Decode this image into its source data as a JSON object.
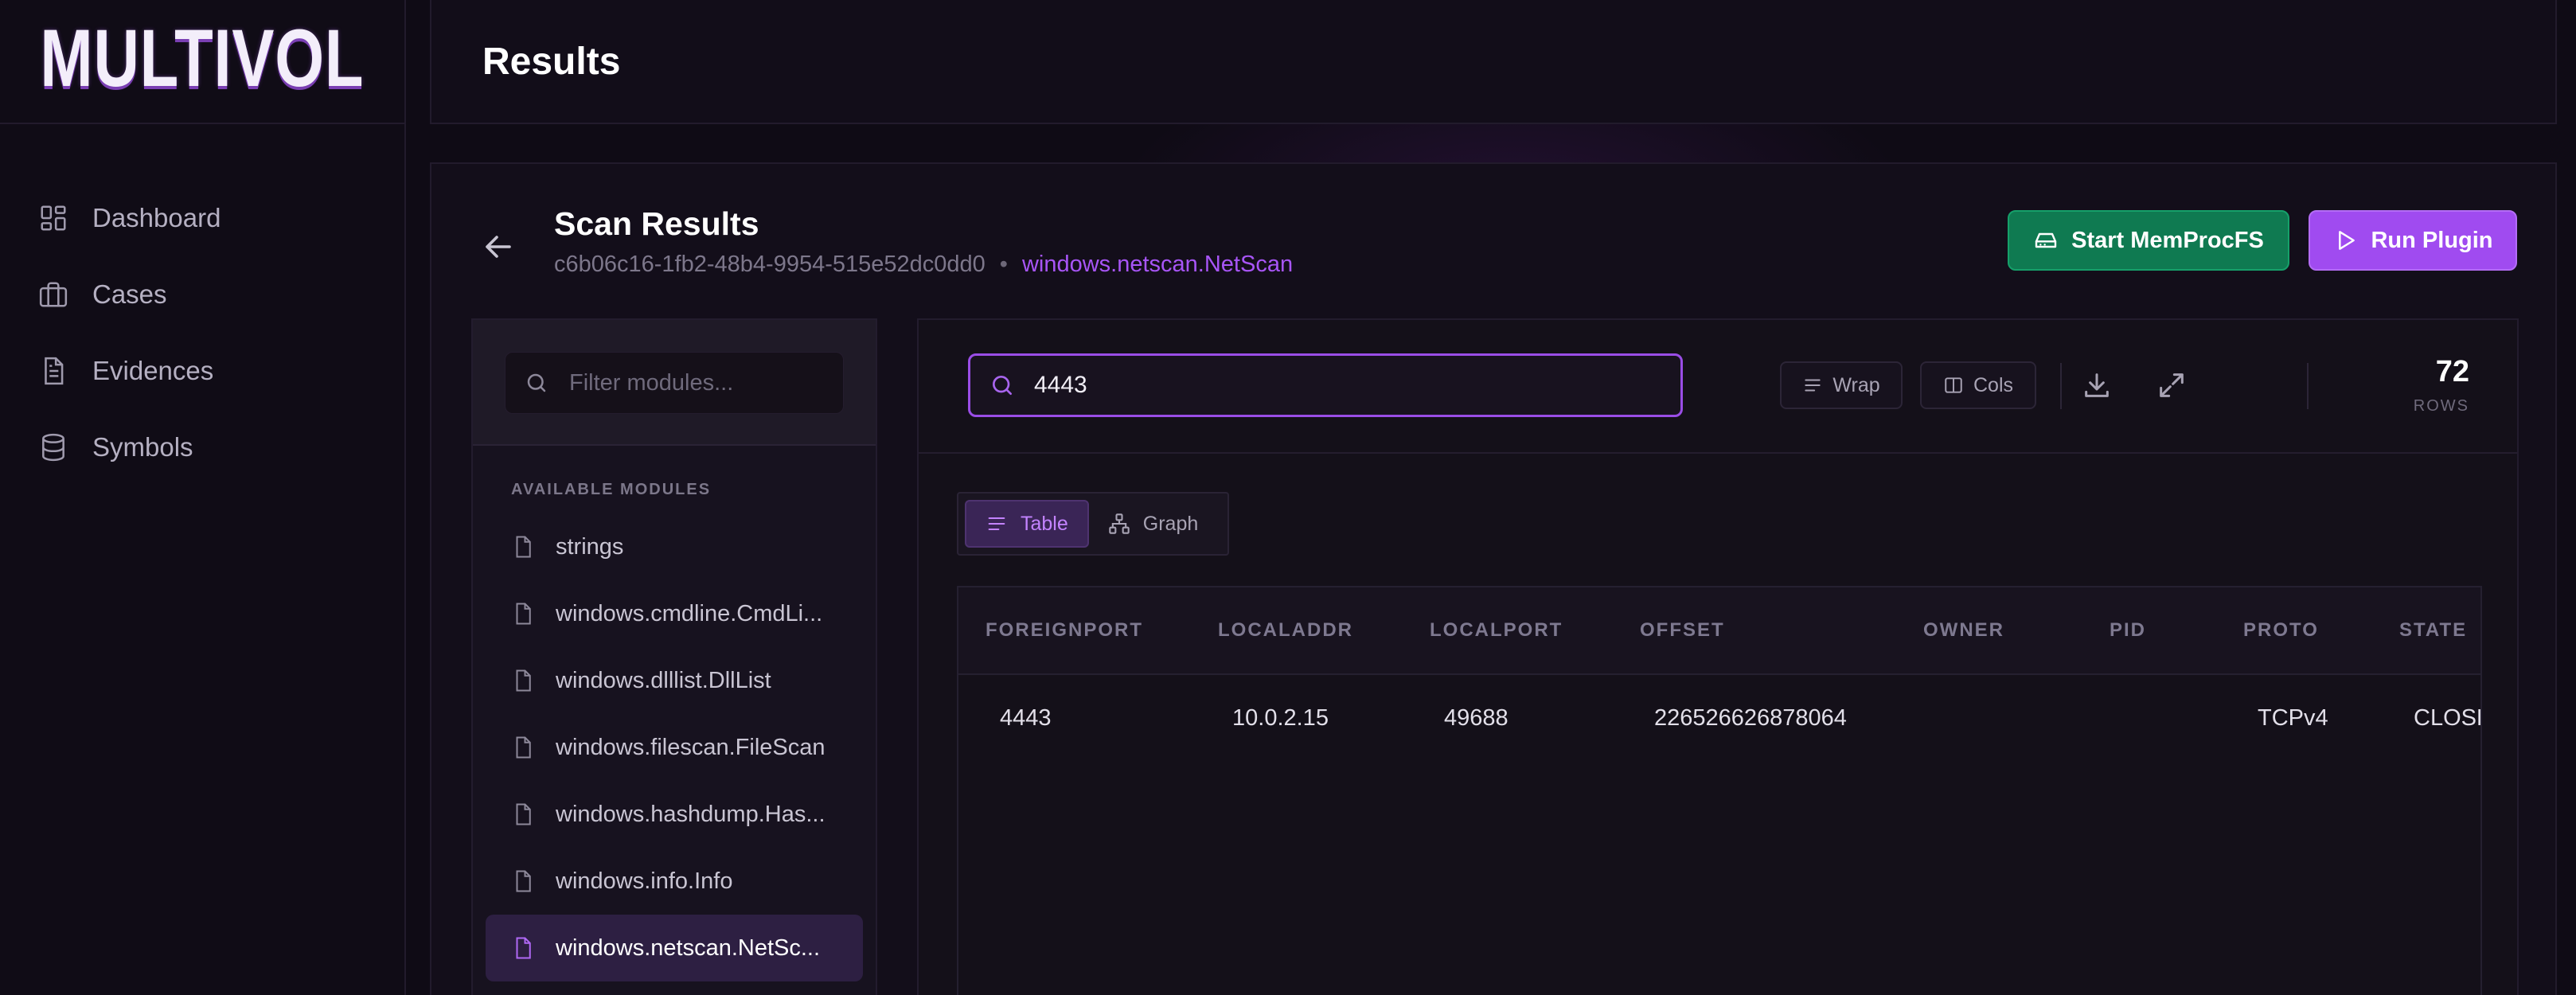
{
  "app": {
    "logo": "MULTIVOL"
  },
  "sidebar": {
    "items": [
      {
        "label": "Dashboard",
        "icon": "dashboard-icon"
      },
      {
        "label": "Cases",
        "icon": "briefcase-icon"
      },
      {
        "label": "Evidences",
        "icon": "document-icon"
      },
      {
        "label": "Symbols",
        "icon": "database-icon"
      }
    ]
  },
  "header": {
    "title": "Results"
  },
  "scan": {
    "title": "Scan Results",
    "id": "c6b06c16-1fb2-48b4-9954-515e52dc0dd0",
    "separator": "•",
    "plugin": "windows.netscan.NetScan"
  },
  "actions": {
    "memprocfs_label": "Start MemProcFS",
    "run_plugin_label": "Run Plugin"
  },
  "modules": {
    "filter_placeholder": "Filter modules...",
    "heading": "AVAILABLE MODULES",
    "items": [
      {
        "label": "strings"
      },
      {
        "label": "windows.cmdline.CmdLi..."
      },
      {
        "label": "windows.dlllist.DllList"
      },
      {
        "label": "windows.filescan.FileScan"
      },
      {
        "label": "windows.hashdump.Has..."
      },
      {
        "label": "windows.info.Info"
      },
      {
        "label": "windows.netscan.NetSc...",
        "active": true
      }
    ]
  },
  "results": {
    "search_value": "4443",
    "wrap_label": "Wrap",
    "cols_label": "Cols",
    "rows_count": "72",
    "rows_label": "ROWS",
    "view_table_label": "Table",
    "view_graph_label": "Graph",
    "columns": [
      "FOREIGNPORT",
      "LOCALADDR",
      "LOCALPORT",
      "OFFSET",
      "OWNER",
      "PID",
      "PROTO",
      "STATE"
    ],
    "rows": [
      [
        "4443",
        "10.0.2.15",
        "49688",
        "226526626878064",
        "",
        "",
        "TCPv4",
        "CLOSED"
      ]
    ]
  },
  "colors": {
    "accent": "#a855f7",
    "success": "#0f7a51",
    "background": "#0f0b15"
  }
}
